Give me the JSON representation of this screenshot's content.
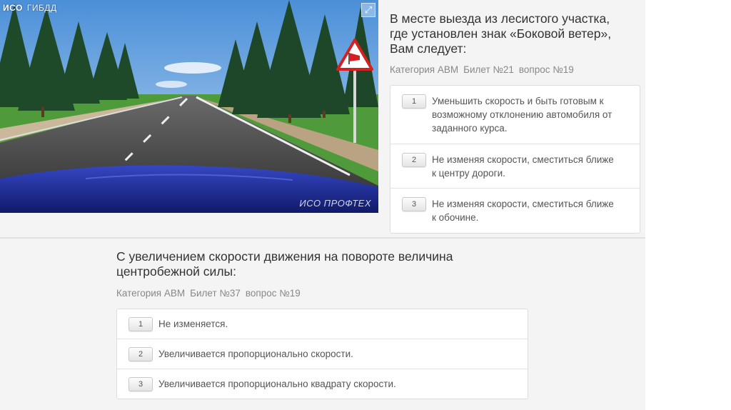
{
  "q1": {
    "title": "В месте выезда из лесистого участка, где установлен знак «Боковой ветер», Вам следует:",
    "title_lines": [
      "В месте выезда из лесистого участка,",
      "где установлен знак «Боковой ветер»,",
      "Вам следует:"
    ],
    "meta": {
      "category": "Категория ABM",
      "ticket": "Билет №21",
      "question": "вопрос №19"
    },
    "image": {
      "brand": "ИСО",
      "brand_sub": "ГИБДД",
      "watermark": "ИСО ПРОФТЕХ",
      "expand_icon": "expand-icon",
      "sign_icon": "crosswind-sign-icon"
    },
    "answers": [
      {
        "num": "1",
        "lines": [
          "Уменьшить скорость и быть готовым к",
          "возможному отклонению автомобиля от",
          "заданного курса."
        ]
      },
      {
        "num": "2",
        "lines": [
          "Не изменяя скорости, сместиться ближе",
          "к центру дороги."
        ]
      },
      {
        "num": "3",
        "lines": [
          "Не изменяя скорости, сместиться ближе",
          "к обочине."
        ]
      }
    ]
  },
  "q2": {
    "title_lines": [
      "С увеличением скорости движения на повороте величина",
      "центробежной силы:"
    ],
    "meta": {
      "category": "Категория ABM",
      "ticket": "Билет №37",
      "question": "вопрос №19"
    },
    "answers": [
      {
        "num": "1",
        "text": "Не изменяется."
      },
      {
        "num": "2",
        "text": "Увеличивается пропорционально скорости."
      },
      {
        "num": "3",
        "text": "Увеличивается пропорционально квадрату скорости."
      }
    ]
  },
  "colors": {
    "panel_bg": "#f4f4f4",
    "car_hood": "#1f2f9a",
    "sky": "#5d9fe0",
    "grass": "#4f9a3a"
  }
}
